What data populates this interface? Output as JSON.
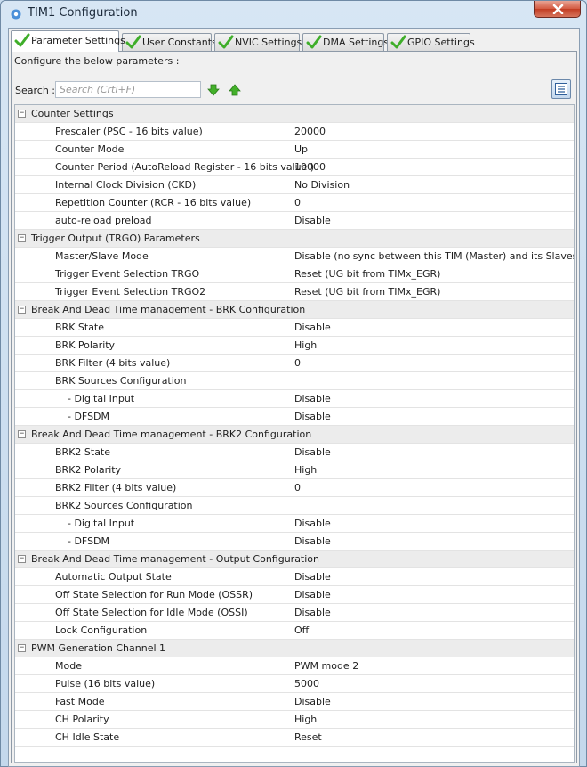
{
  "window": {
    "title": "TIM1 Configuration"
  },
  "tabs": [
    {
      "label": "Parameter Settings",
      "active": true
    },
    {
      "label": "User Constants",
      "active": false
    },
    {
      "label": "NVIC Settings",
      "active": false
    },
    {
      "label": "DMA Settings",
      "active": false
    },
    {
      "label": "GPIO Settings",
      "active": false
    }
  ],
  "panel": {
    "configure_text": "Configure the below parameters :",
    "search_label": "Search :",
    "search_placeholder": "Search (Crtl+F)",
    "search_value": ""
  },
  "colors": {
    "check_green": "#3fae2a",
    "close_red": "#c9462c",
    "accent_blue": "#2f5f9a"
  },
  "groups": [
    {
      "title": "Counter Settings",
      "toggle": "−",
      "params": [
        {
          "name": "Prescaler (PSC - 16 bits value)",
          "value": "20000"
        },
        {
          "name": "Counter Mode",
          "value": "Up"
        },
        {
          "name": "Counter Period (AutoReload Register - 16 bits value )",
          "value": "10000"
        },
        {
          "name": "Internal Clock Division (CKD)",
          "value": "No Division"
        },
        {
          "name": "Repetition Counter (RCR - 16 bits value)",
          "value": "0"
        },
        {
          "name": "auto-reload preload",
          "value": "Disable"
        }
      ]
    },
    {
      "title": "Trigger Output (TRGO) Parameters",
      "toggle": "−",
      "params": [
        {
          "name": "Master/Slave Mode",
          "value": "Disable (no sync between this TIM (Master) and its Slaves"
        },
        {
          "name": "Trigger Event Selection TRGO",
          "value": "Reset (UG bit from TIMx_EGR)"
        },
        {
          "name": "Trigger Event Selection TRGO2",
          "value": "Reset (UG bit from TIMx_EGR)"
        }
      ]
    },
    {
      "title": "Break And Dead Time management - BRK Configuration",
      "toggle": "−",
      "params": [
        {
          "name": "BRK State",
          "value": "Disable"
        },
        {
          "name": "BRK Polarity",
          "value": "High"
        },
        {
          "name": "BRK Filter (4 bits value)",
          "value": "0"
        },
        {
          "name": "BRK Sources Configuration",
          "value": ""
        },
        {
          "name": "- Digital Input",
          "value": "Disable",
          "sub": true
        },
        {
          "name": "- DFSDM",
          "value": "Disable",
          "sub": true
        }
      ]
    },
    {
      "title": "Break And Dead Time management - BRK2 Configuration",
      "toggle": "−",
      "params": [
        {
          "name": "BRK2 State",
          "value": "Disable"
        },
        {
          "name": "BRK2 Polarity",
          "value": "High"
        },
        {
          "name": "BRK2 Filter (4 bits value)",
          "value": "0"
        },
        {
          "name": "BRK2 Sources Configuration",
          "value": ""
        },
        {
          "name": "- Digital Input",
          "value": "Disable",
          "sub": true
        },
        {
          "name": "- DFSDM",
          "value": "Disable",
          "sub": true
        }
      ]
    },
    {
      "title": "Break And Dead Time management - Output Configuration",
      "toggle": "−",
      "params": [
        {
          "name": "Automatic Output State",
          "value": "Disable"
        },
        {
          "name": "Off State Selection for Run Mode (OSSR)",
          "value": "Disable"
        },
        {
          "name": "Off State Selection for Idle Mode (OSSI)",
          "value": "Disable"
        },
        {
          "name": "Lock Configuration",
          "value": "Off"
        }
      ]
    },
    {
      "title": "PWM Generation Channel 1",
      "toggle": "−",
      "params": [
        {
          "name": "Mode",
          "value": "PWM mode 2"
        },
        {
          "name": "Pulse (16 bits value)",
          "value": "5000"
        },
        {
          "name": "Fast Mode",
          "value": "Disable"
        },
        {
          "name": "CH Polarity",
          "value": "High"
        },
        {
          "name": "CH Idle State",
          "value": "Reset"
        }
      ]
    }
  ]
}
